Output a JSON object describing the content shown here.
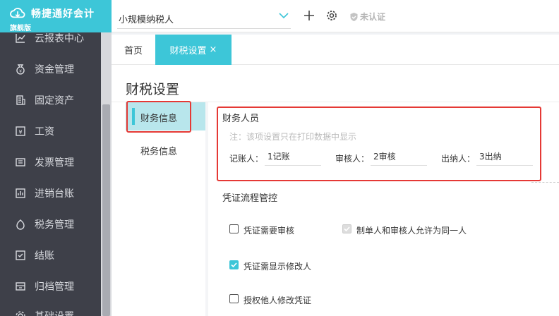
{
  "sidebar": {
    "logo_title": "畅捷通好会计",
    "logo_badge": "旗舰版",
    "items": [
      {
        "label": "云报表中心",
        "icon": "chart-line-icon"
      },
      {
        "label": "资金管理",
        "icon": "money-bag-icon"
      },
      {
        "label": "固定资产",
        "icon": "building-icon"
      },
      {
        "label": "工资",
        "icon": "payroll-icon"
      },
      {
        "label": "发票管理",
        "icon": "invoice-icon"
      },
      {
        "label": "进销台账",
        "icon": "ledger-icon"
      },
      {
        "label": "税务管理",
        "icon": "tax-icon"
      },
      {
        "label": "结账",
        "icon": "close-period-icon"
      },
      {
        "label": "归档管理",
        "icon": "archive-icon"
      },
      {
        "label": "基础设置",
        "icon": "settings-icon"
      }
    ]
  },
  "topbar": {
    "company": "小规模纳税人",
    "auth_status": "未认证"
  },
  "tabs": {
    "home": "首页",
    "active": "财税设置",
    "close_symbol": "×"
  },
  "page": {
    "title": "财税设置",
    "subnav": [
      "财务信息",
      "税务信息"
    ]
  },
  "finance_staff": {
    "title": "财务人员",
    "hint": "注：该项设置只在打印数据中显示",
    "bookkeeper_label": "记账人：",
    "bookkeeper_value": "1记账",
    "reviewer_label": "审核人：",
    "reviewer_value": "2审核",
    "cashier_label": "出纳人：",
    "cashier_value": "3出纳"
  },
  "voucher_flow": {
    "title": "凭证流程管控",
    "options": [
      {
        "label": "凭证需要审核",
        "checked": false
      },
      {
        "label": "制单人和审核人允许为同一人",
        "checked": true,
        "disabled": true
      },
      {
        "label": "凭证需显示修改人",
        "checked": true
      },
      {
        "label": "授权他人修改凭证",
        "checked": false
      }
    ]
  },
  "colors": {
    "accent": "#3dc6d8",
    "sidebar_bg": "#3e4049",
    "highlight_border": "#e53935"
  }
}
